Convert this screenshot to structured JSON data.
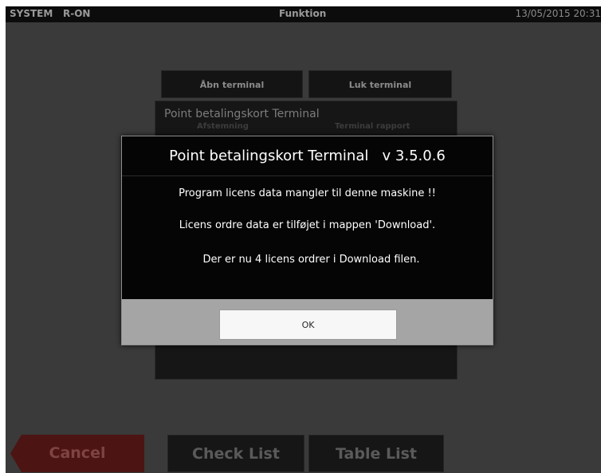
{
  "topbar": {
    "system": "SYSTEM",
    "mode": "R-ON",
    "function": "Funktion",
    "datetime": "13/05/2015 20:31"
  },
  "terminal_buttons": {
    "open": "Åbn terminal",
    "close": "Luk terminal"
  },
  "panel": {
    "title": "Point betalingskort Terminal",
    "hidden_left": "Afstemning",
    "hidden_right": "Terminal rapport"
  },
  "dialog": {
    "title": "Point betalingskort Terminal   v 3.5.0.6",
    "line1": "Program licens data mangler til denne maskine !!",
    "line2": "Licens ordre data er tilføjet i mappen 'Download'.",
    "line3": "Der er nu 4 licens ordrer i Download filen.",
    "ok": "OK"
  },
  "bottom": {
    "cancel": "Cancel",
    "check_list": "Check List",
    "table_list": "Table List"
  }
}
